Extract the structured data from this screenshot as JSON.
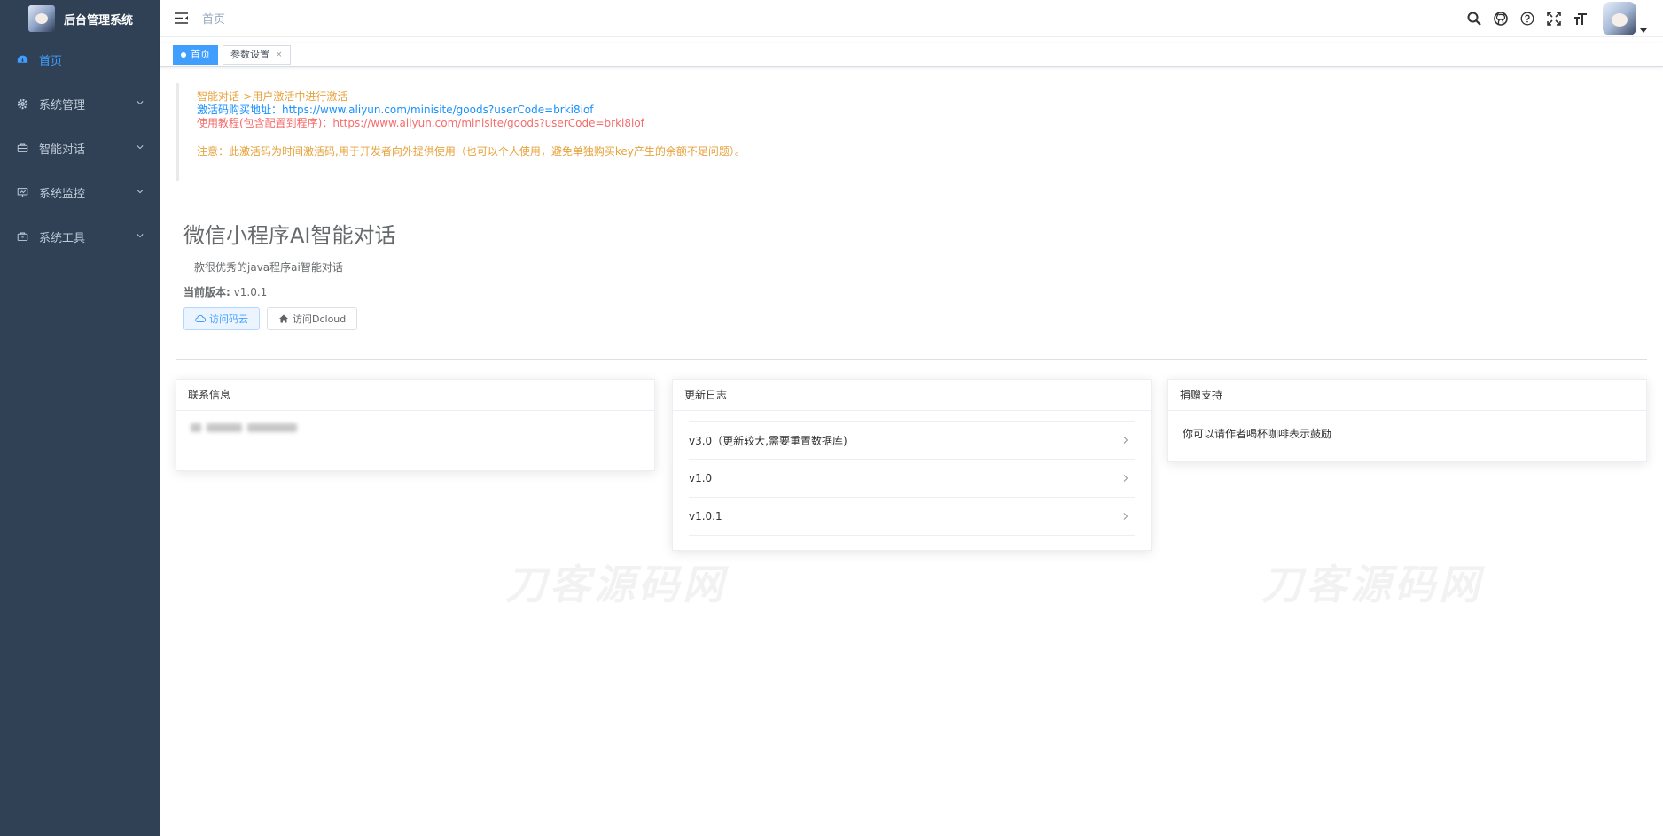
{
  "app": {
    "title": "后台管理系统"
  },
  "sidebar": {
    "items": [
      {
        "label": "首页",
        "icon": "dashboard-icon",
        "active": true
      },
      {
        "label": "系统管理",
        "icon": "gear-icon"
      },
      {
        "label": "智能对话",
        "icon": "chat-icon"
      },
      {
        "label": "系统监控",
        "icon": "monitor-icon"
      },
      {
        "label": "系统工具",
        "icon": "tool-icon"
      }
    ]
  },
  "navbar": {
    "breadcrumb": "首页",
    "tools": [
      "search-icon",
      "github-icon",
      "help-icon",
      "fullscreen-icon",
      "font-size-icon"
    ]
  },
  "tags": [
    {
      "label": "首页",
      "active": true
    },
    {
      "label": "参数设置",
      "active": false
    }
  ],
  "notice": {
    "line1": "智能对话->用户激活中进行激活",
    "line2": "激活码购买地址：https://www.aliyun.com/minisite/goods?userCode=brki8iof",
    "line3": "使用教程(包含配置到程序)：https://www.aliyun.com/minisite/goods?userCode=brki8iof",
    "line4": "注意：此激活码为时间激活码,用于开发者向外提供使用（也可以个人使用，避免单独购买key产生的余额不足问题）。"
  },
  "intro": {
    "title": "微信小程序AI智能对话",
    "desc": "一款很优秀的java程序ai智能对话",
    "version_label": "当前版本:",
    "version_value": "v1.0.1",
    "btn_gitee": "访问码云",
    "btn_dcloud": "访问Dcloud"
  },
  "cards": {
    "contact": {
      "title": "联系信息"
    },
    "changelog": {
      "title": "更新日志",
      "items": [
        "v3.0（更新较大,需要重置数据库)",
        "v1.0",
        "v1.0.1"
      ]
    },
    "donate": {
      "title": "捐赠支持",
      "text": "你可以请作者喝杯咖啡表示鼓励"
    }
  },
  "watermark": "刀客源码网",
  "colors": {
    "sidebar_bg": "#304156",
    "accent": "#409eff",
    "orange": "#e6a23c",
    "red": "#f56c6c"
  }
}
